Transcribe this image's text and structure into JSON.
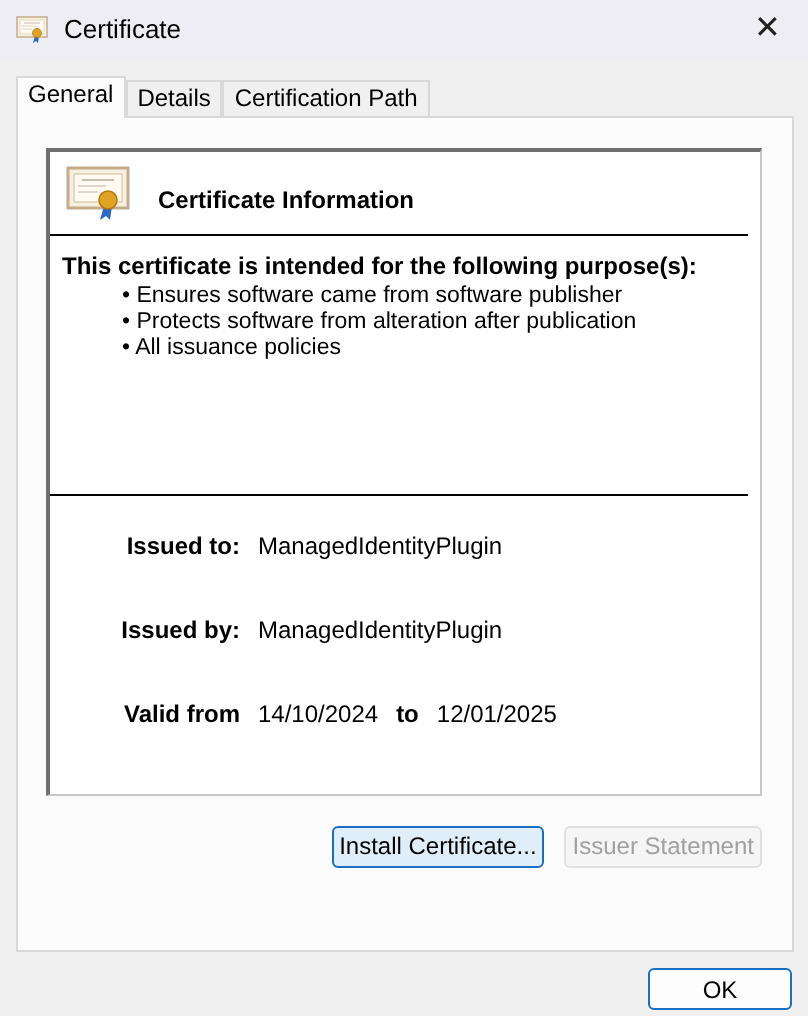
{
  "window": {
    "title": "Certificate",
    "close": "✕"
  },
  "tabs": [
    {
      "label": "General",
      "selected": true
    },
    {
      "label": "Details",
      "selected": false
    },
    {
      "label": "Certification Path",
      "selected": false
    }
  ],
  "info": {
    "title": "Certificate Information",
    "purpose_heading": "This certificate is intended for the following purpose(s):",
    "purposes": [
      "• Ensures software came from software publisher",
      "• Protects software from alteration after publication",
      "• All issuance policies"
    ]
  },
  "issued_to": {
    "label": "Issued to:",
    "value": "ManagedIdentityPlugin"
  },
  "issued_by": {
    "label": "Issued by:",
    "value": "ManagedIdentityPlugin"
  },
  "validity": {
    "label": "Valid from",
    "from": "14/10/2024",
    "separator": "to",
    "to": "12/01/2025"
  },
  "buttons": [
    {
      "label": "Install Certificate...",
      "disabled": false,
      "focused": true
    },
    {
      "label": "Issuer Statement",
      "disabled": true,
      "focused": false
    }
  ],
  "ok_button": {
    "label": "OK"
  }
}
